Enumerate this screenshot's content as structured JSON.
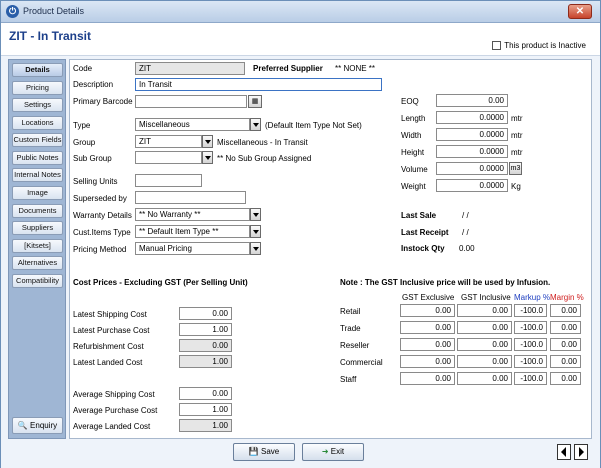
{
  "window": {
    "title": "Product Details",
    "close_label": "✕"
  },
  "header": {
    "product_title": "ZIT - In Transit",
    "inactive_label": "This product is Inactive"
  },
  "sidebar": {
    "items": [
      "Details",
      "Pricing",
      "Settings",
      "Locations",
      "Custom Fields",
      "Public Notes",
      "Internal Notes",
      "Image",
      "Documents",
      "Suppliers",
      "[Kitsets]",
      "Alternatives",
      "Compatibility"
    ],
    "enquiry": "Enquiry"
  },
  "details": {
    "code_label": "Code",
    "code_value": "ZIT",
    "preferred_supplier_label": "Preferred Supplier",
    "preferred_supplier_value": "** NONE **",
    "description_label": "Description",
    "description_value": "In Transit",
    "barcode_label": "Primary Barcode",
    "barcode_value": "",
    "type_label": "Type",
    "type_value": "Miscellaneous",
    "type_note": "(Default Item Type Not Set)",
    "group_label": "Group",
    "group_value": "ZIT",
    "group_note": "Miscellaneous - In Transit",
    "subgroup_label": "Sub Group",
    "subgroup_value": "",
    "subgroup_note": "** No Sub Group Assigned",
    "selling_units_label": "Selling Units",
    "selling_units_value": "",
    "superseded_label": "Superseded by",
    "superseded_value": "",
    "warranty_label": "Warranty Details",
    "warranty_value": "** No Warranty **",
    "cust_items_label": "Cust.Items Type",
    "cust_items_value": "** Default Item Type **",
    "pricing_method_label": "Pricing Method",
    "pricing_method_value": "Manual Pricing"
  },
  "dims": {
    "eoq_label": "EOQ",
    "eoq_value": "0.00",
    "length_label": "Length",
    "length_value": "0.0000",
    "length_unit": "mtr",
    "width_label": "Width",
    "width_value": "0.0000",
    "width_unit": "mtr",
    "height_label": "Height",
    "height_value": "0.0000",
    "height_unit": "mtr",
    "volume_label": "Volume",
    "volume_value": "0.0000",
    "volume_unit": "m3",
    "weight_label": "Weight",
    "weight_value": "0.0000",
    "weight_unit": "Kg"
  },
  "history": {
    "last_sale_label": "Last Sale",
    "last_sale_value": "/ /",
    "last_receipt_label": "Last Receipt",
    "last_receipt_value": "/ /",
    "instock_label": "Instock Qty",
    "instock_value": "0.00"
  },
  "costs": {
    "heading": "Cost Prices - Excluding GST (Per Selling Unit)",
    "latest_shipping_label": "Latest Shipping Cost",
    "latest_shipping_value": "0.00",
    "latest_purchase_label": "Latest Purchase Cost",
    "latest_purchase_value": "1.00",
    "refurb_label": "Refurbishment Cost",
    "refurb_value": "0.00",
    "latest_landed_label": "Latest Landed Cost",
    "latest_landed_value": "1.00",
    "avg_shipping_label": "Average Shipping Cost",
    "avg_shipping_value": "0.00",
    "avg_purchase_label": "Average Purchase Cost",
    "avg_purchase_value": "1.00",
    "avg_landed_label": "Average Landed Cost",
    "avg_landed_value": "1.00"
  },
  "prices": {
    "note": "Note : The GST Inclusive price will be used by Infusion.",
    "col_gst_excl": "GST Exclusive",
    "col_gst_incl": "GST Inclusive",
    "col_markup": "Markup %",
    "col_margin": "Margin %",
    "markup_color": "#2040c0",
    "margin_color": "#d02020",
    "rows": [
      {
        "label": "Retail",
        "excl": "0.00",
        "incl": "0.00",
        "markup": "-100.0",
        "margin": "0.00"
      },
      {
        "label": "Trade",
        "excl": "0.00",
        "incl": "0.00",
        "markup": "-100.0",
        "margin": "0.00"
      },
      {
        "label": "Reseller",
        "excl": "0.00",
        "incl": "0.00",
        "markup": "-100.0",
        "margin": "0.00"
      },
      {
        "label": "Commercial",
        "excl": "0.00",
        "incl": "0.00",
        "markup": "-100.0",
        "margin": "0.00"
      },
      {
        "label": "Staff",
        "excl": "0.00",
        "incl": "0.00",
        "markup": "-100.0",
        "margin": "0.00"
      }
    ]
  },
  "footer": {
    "save_label": "Save",
    "exit_label": "Exit"
  }
}
